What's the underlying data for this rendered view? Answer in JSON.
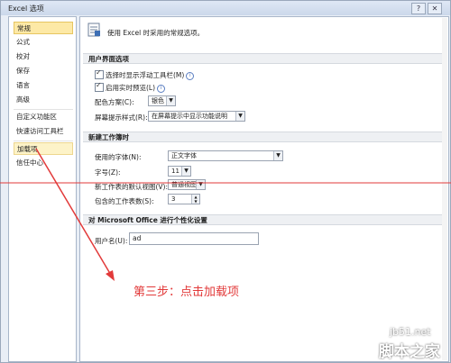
{
  "window": {
    "title": "Excel 选项",
    "controls": [
      "?",
      "✕"
    ]
  },
  "sidebar": {
    "items": [
      {
        "label": "常规"
      },
      {
        "label": "公式"
      },
      {
        "label": "校对"
      },
      {
        "label": "保存"
      },
      {
        "label": "语言"
      },
      {
        "label": "高级"
      },
      {
        "label": "自定义功能区"
      },
      {
        "label": "快速访问工具栏"
      },
      {
        "label": "加载项"
      },
      {
        "label": "信任中心"
      }
    ],
    "active_index": 0,
    "hover_index": 8
  },
  "main": {
    "header_text": "使用 Excel 时采用的常规选项。",
    "ui_section": {
      "title": "用户界面选项",
      "options": [
        {
          "label": "选择时显示浮动工具栏(M)",
          "checked": true
        },
        {
          "label": "启用实时预览(L)",
          "checked": true
        }
      ],
      "color_scheme": {
        "label": "配色方案(C):",
        "value": "银色"
      },
      "tooltip_style": {
        "label": "屏幕提示样式(R):",
        "value": "在屏幕提示中显示功能说明"
      }
    },
    "workbook_section": {
      "title": "新建工作簿时",
      "font": {
        "label": "使用的字体(N):",
        "value": "正文字体"
      },
      "size": {
        "label": "字号(Z):",
        "value": "11"
      },
      "default_view": {
        "label": "新工作表的默认视图(V):",
        "value": "普通视图"
      },
      "sheet_count": {
        "label": "包含的工作表数(S):",
        "value": "3"
      }
    },
    "personalize_section": {
      "title": "对 Microsoft Office 进行个性化设置",
      "username": {
        "label": "用户名(U):",
        "value": "ad"
      }
    }
  },
  "annotation": {
    "text": "第三步：点击加载项",
    "color": "#e23a3a"
  },
  "watermark": {
    "line1": "jb51.net",
    "line2": "脚本之家"
  }
}
